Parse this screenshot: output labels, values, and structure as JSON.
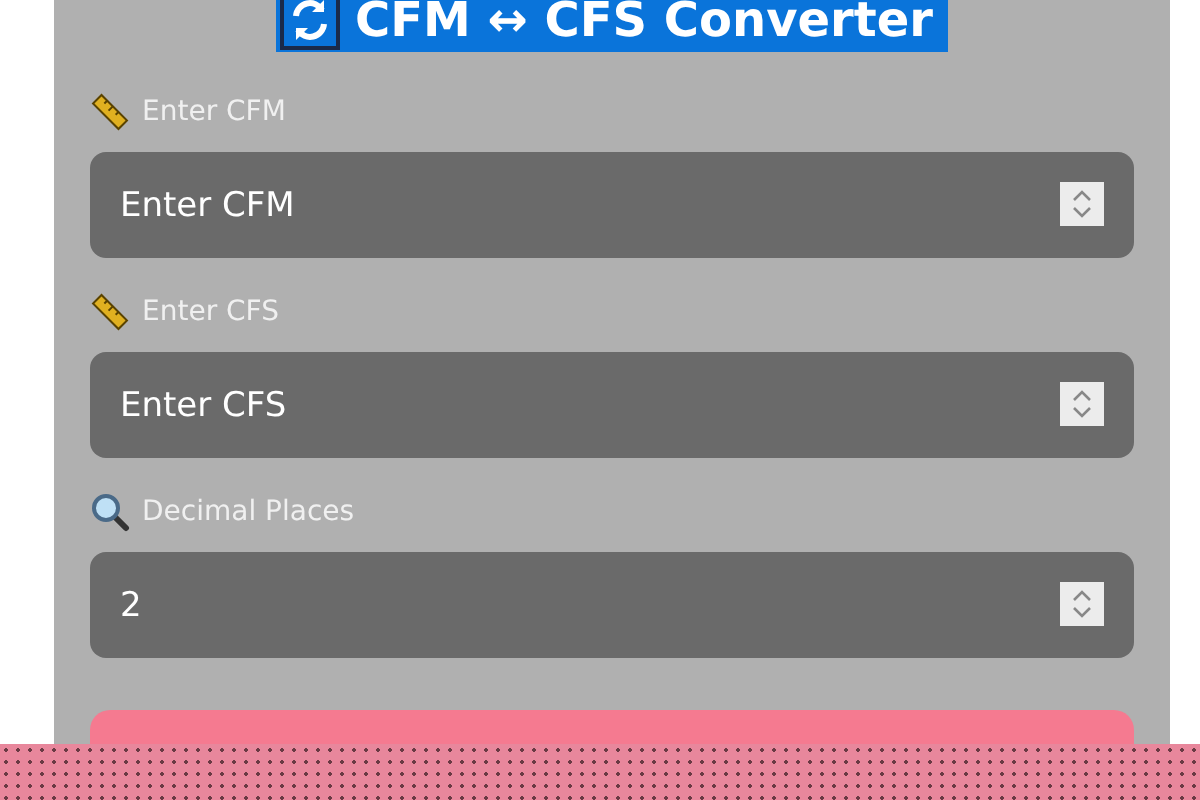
{
  "title": {
    "text": "CFM ↔ CFS Converter"
  },
  "fields": [
    {
      "kind": "ruler",
      "label": "Enter CFM",
      "placeholder": "Enter CFM"
    },
    {
      "kind": "ruler",
      "label": "Enter CFS",
      "placeholder": "Enter CFS"
    },
    {
      "kind": "search",
      "label": "Decimal Places",
      "value": "2"
    }
  ]
}
